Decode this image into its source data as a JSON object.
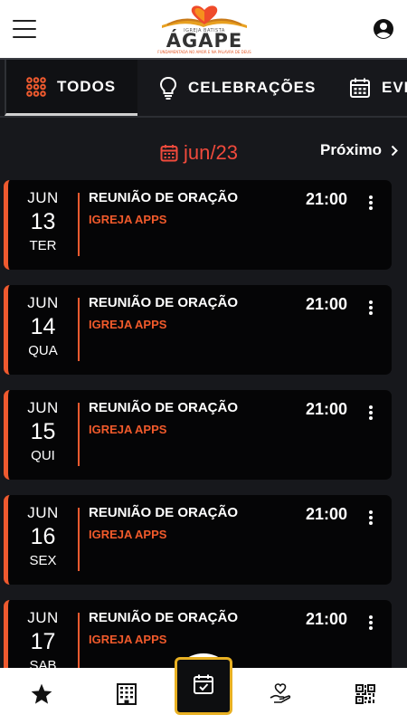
{
  "header": {
    "logo_small": "IGREJA BATISTA",
    "logo_name": "ÁGAPE",
    "logo_tagline": "FUNDAMENTADA NO AMOR E NA PALAVRA DE DEUS"
  },
  "tabs": [
    {
      "label": "TODOS",
      "icon": "grid-dots-icon",
      "active": true
    },
    {
      "label": "CELEBRAÇÕES",
      "icon": "lightbulb-icon",
      "active": false
    },
    {
      "label": "EVE",
      "icon": "calendar-icon",
      "active": false
    }
  ],
  "month": {
    "label": "jun/23",
    "next_label": "Próximo"
  },
  "events": [
    {
      "month": "JUN",
      "day": "13",
      "weekday": "TER",
      "title": "REUNIÃO DE ORAÇÃO",
      "org": "IGREJA APPS",
      "time": "21:00"
    },
    {
      "month": "JUN",
      "day": "14",
      "weekday": "QUA",
      "title": "REUNIÃO DE ORAÇÃO",
      "org": "IGREJA APPS",
      "time": "21:00"
    },
    {
      "month": "JUN",
      "day": "15",
      "weekday": "QUI",
      "title": "REUNIÃO DE ORAÇÃO",
      "org": "IGREJA APPS",
      "time": "21:00"
    },
    {
      "month": "JUN",
      "day": "16",
      "weekday": "SEX",
      "title": "REUNIÃO DE ORAÇÃO",
      "org": "IGREJA APPS",
      "time": "21:00"
    },
    {
      "month": "JUN",
      "day": "17",
      "weekday": "SAB",
      "title": "REUNIÃO DE ORAÇÃO",
      "org": "IGREJA APPS",
      "time": "21:00"
    }
  ],
  "bottom_nav": [
    {
      "icon": "star-icon"
    },
    {
      "icon": "building-icon"
    },
    {
      "icon": "calendar-check-icon",
      "active": true
    },
    {
      "icon": "heart-hand-icon"
    },
    {
      "icon": "qr-code-icon"
    }
  ],
  "colors": {
    "accent": "#ef5a2f",
    "month_red": "#f04a3c",
    "nav_highlight": "#e8b022",
    "background": "#17181c",
    "card": "#050506"
  }
}
